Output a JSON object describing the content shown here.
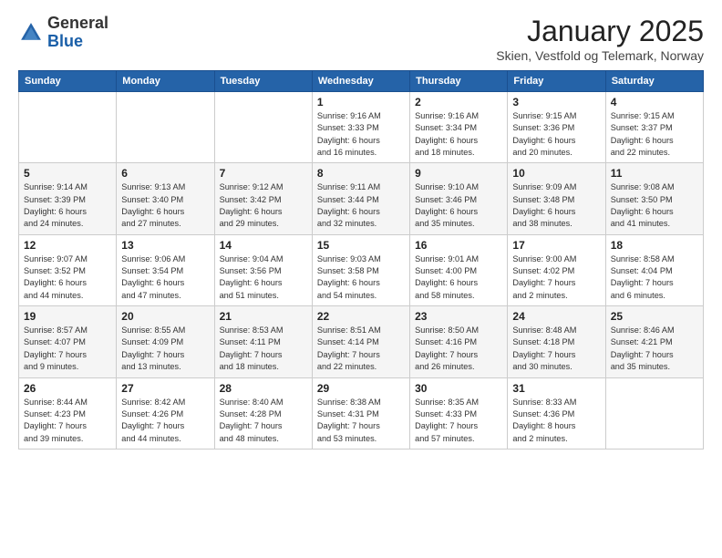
{
  "logo": {
    "general": "General",
    "blue": "Blue"
  },
  "header": {
    "title": "January 2025",
    "subtitle": "Skien, Vestfold og Telemark, Norway"
  },
  "days_of_week": [
    "Sunday",
    "Monday",
    "Tuesday",
    "Wednesday",
    "Thursday",
    "Friday",
    "Saturday"
  ],
  "weeks": [
    [
      {
        "day": "",
        "info": ""
      },
      {
        "day": "",
        "info": ""
      },
      {
        "day": "",
        "info": ""
      },
      {
        "day": "1",
        "info": "Sunrise: 9:16 AM\nSunset: 3:33 PM\nDaylight: 6 hours\nand 16 minutes."
      },
      {
        "day": "2",
        "info": "Sunrise: 9:16 AM\nSunset: 3:34 PM\nDaylight: 6 hours\nand 18 minutes."
      },
      {
        "day": "3",
        "info": "Sunrise: 9:15 AM\nSunset: 3:36 PM\nDaylight: 6 hours\nand 20 minutes."
      },
      {
        "day": "4",
        "info": "Sunrise: 9:15 AM\nSunset: 3:37 PM\nDaylight: 6 hours\nand 22 minutes."
      }
    ],
    [
      {
        "day": "5",
        "info": "Sunrise: 9:14 AM\nSunset: 3:39 PM\nDaylight: 6 hours\nand 24 minutes."
      },
      {
        "day": "6",
        "info": "Sunrise: 9:13 AM\nSunset: 3:40 PM\nDaylight: 6 hours\nand 27 minutes."
      },
      {
        "day": "7",
        "info": "Sunrise: 9:12 AM\nSunset: 3:42 PM\nDaylight: 6 hours\nand 29 minutes."
      },
      {
        "day": "8",
        "info": "Sunrise: 9:11 AM\nSunset: 3:44 PM\nDaylight: 6 hours\nand 32 minutes."
      },
      {
        "day": "9",
        "info": "Sunrise: 9:10 AM\nSunset: 3:46 PM\nDaylight: 6 hours\nand 35 minutes."
      },
      {
        "day": "10",
        "info": "Sunrise: 9:09 AM\nSunset: 3:48 PM\nDaylight: 6 hours\nand 38 minutes."
      },
      {
        "day": "11",
        "info": "Sunrise: 9:08 AM\nSunset: 3:50 PM\nDaylight: 6 hours\nand 41 minutes."
      }
    ],
    [
      {
        "day": "12",
        "info": "Sunrise: 9:07 AM\nSunset: 3:52 PM\nDaylight: 6 hours\nand 44 minutes."
      },
      {
        "day": "13",
        "info": "Sunrise: 9:06 AM\nSunset: 3:54 PM\nDaylight: 6 hours\nand 47 minutes."
      },
      {
        "day": "14",
        "info": "Sunrise: 9:04 AM\nSunset: 3:56 PM\nDaylight: 6 hours\nand 51 minutes."
      },
      {
        "day": "15",
        "info": "Sunrise: 9:03 AM\nSunset: 3:58 PM\nDaylight: 6 hours\nand 54 minutes."
      },
      {
        "day": "16",
        "info": "Sunrise: 9:01 AM\nSunset: 4:00 PM\nDaylight: 6 hours\nand 58 minutes."
      },
      {
        "day": "17",
        "info": "Sunrise: 9:00 AM\nSunset: 4:02 PM\nDaylight: 7 hours\nand 2 minutes."
      },
      {
        "day": "18",
        "info": "Sunrise: 8:58 AM\nSunset: 4:04 PM\nDaylight: 7 hours\nand 6 minutes."
      }
    ],
    [
      {
        "day": "19",
        "info": "Sunrise: 8:57 AM\nSunset: 4:07 PM\nDaylight: 7 hours\nand 9 minutes."
      },
      {
        "day": "20",
        "info": "Sunrise: 8:55 AM\nSunset: 4:09 PM\nDaylight: 7 hours\nand 13 minutes."
      },
      {
        "day": "21",
        "info": "Sunrise: 8:53 AM\nSunset: 4:11 PM\nDaylight: 7 hours\nand 18 minutes."
      },
      {
        "day": "22",
        "info": "Sunrise: 8:51 AM\nSunset: 4:14 PM\nDaylight: 7 hours\nand 22 minutes."
      },
      {
        "day": "23",
        "info": "Sunrise: 8:50 AM\nSunset: 4:16 PM\nDaylight: 7 hours\nand 26 minutes."
      },
      {
        "day": "24",
        "info": "Sunrise: 8:48 AM\nSunset: 4:18 PM\nDaylight: 7 hours\nand 30 minutes."
      },
      {
        "day": "25",
        "info": "Sunrise: 8:46 AM\nSunset: 4:21 PM\nDaylight: 7 hours\nand 35 minutes."
      }
    ],
    [
      {
        "day": "26",
        "info": "Sunrise: 8:44 AM\nSunset: 4:23 PM\nDaylight: 7 hours\nand 39 minutes."
      },
      {
        "day": "27",
        "info": "Sunrise: 8:42 AM\nSunset: 4:26 PM\nDaylight: 7 hours\nand 44 minutes."
      },
      {
        "day": "28",
        "info": "Sunrise: 8:40 AM\nSunset: 4:28 PM\nDaylight: 7 hours\nand 48 minutes."
      },
      {
        "day": "29",
        "info": "Sunrise: 8:38 AM\nSunset: 4:31 PM\nDaylight: 7 hours\nand 53 minutes."
      },
      {
        "day": "30",
        "info": "Sunrise: 8:35 AM\nSunset: 4:33 PM\nDaylight: 7 hours\nand 57 minutes."
      },
      {
        "day": "31",
        "info": "Sunrise: 8:33 AM\nSunset: 4:36 PM\nDaylight: 8 hours\nand 2 minutes."
      },
      {
        "day": "",
        "info": ""
      }
    ]
  ]
}
